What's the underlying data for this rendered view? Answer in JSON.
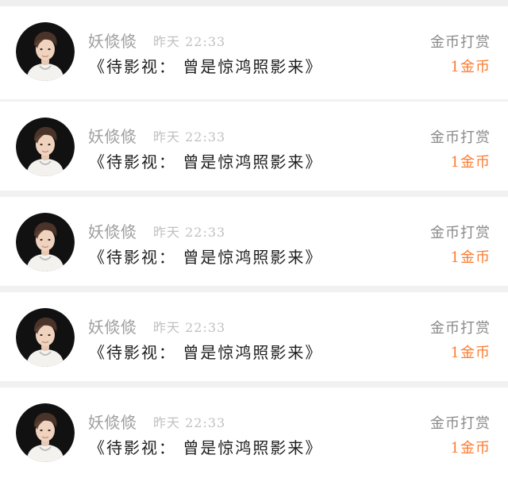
{
  "colors": {
    "background": "#f1f1f1",
    "card": "#ffffff",
    "username": "#a0a0a0",
    "time": "#c0c0c0",
    "message": "#1e1e1e",
    "tip_label": "#8a8a8a",
    "tip_amount": "#ff7a2e"
  },
  "comments": [
    {
      "avatar": "avatar-photo",
      "username": "妖倐倐",
      "time": "昨天 22:33",
      "message": "《待影视： 曾是惊鸿照影来》",
      "tip_label": "金币打赏",
      "tip_amount": "1金币"
    },
    {
      "avatar": "avatar-photo",
      "username": "妖倐倐",
      "time": "昨天 22:33",
      "message": "《待影视： 曾是惊鸿照影来》",
      "tip_label": "金币打赏",
      "tip_amount": "1金币"
    },
    {
      "avatar": "avatar-photo",
      "username": "妖倐倐",
      "time": "昨天 22:33",
      "message": "《待影视： 曾是惊鸿照影来》",
      "tip_label": "金币打赏",
      "tip_amount": "1金币"
    },
    {
      "avatar": "avatar-photo",
      "username": "妖倐倐",
      "time": "昨天 22:33",
      "message": "《待影视： 曾是惊鸿照影来》",
      "tip_label": "金币打赏",
      "tip_amount": "1金币"
    },
    {
      "avatar": "avatar-photo",
      "username": "妖倐倐",
      "time": "昨天 22:33",
      "message": "《待影视： 曾是惊鸿照影来》",
      "tip_label": "金币打赏",
      "tip_amount": "1金币"
    }
  ]
}
